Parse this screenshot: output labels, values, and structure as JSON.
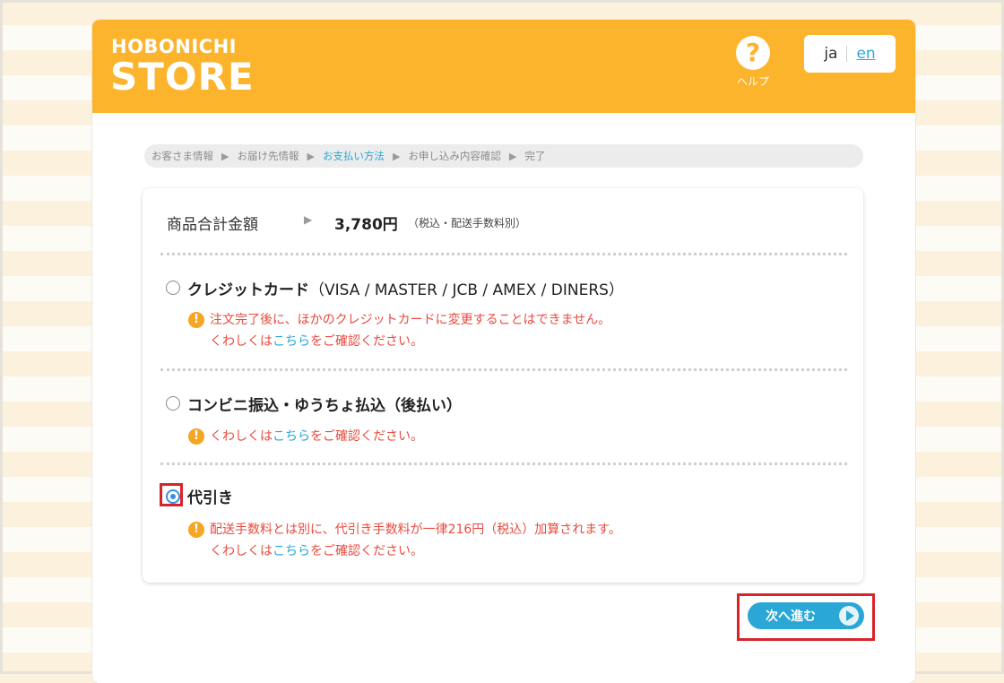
{
  "header": {
    "logo_top": "HOBONICHI",
    "logo_bottom": "STORE",
    "help_icon": "?",
    "help_label": "ヘルプ",
    "lang_ja": "ja",
    "lang_en": "en"
  },
  "steps": [
    {
      "label": "お客さま情報",
      "active": false
    },
    {
      "label": "お届け先情報",
      "active": false
    },
    {
      "label": "お支払い方法",
      "active": true
    },
    {
      "label": "お申し込み内容確認",
      "active": false
    },
    {
      "label": "完了",
      "active": false
    }
  ],
  "step_arrow": "▶",
  "total": {
    "label": "商品合計金額",
    "arrow": "▶",
    "amount": "3,780円",
    "note": "（税込・配送手数料別）"
  },
  "options": [
    {
      "label": "クレジットカード",
      "detail": "（VISA / MASTER / JCB / AMEX / DINERS）",
      "checked": false,
      "warning_line1": "注文完了後に、ほかのクレジットカードに変更することはできません。",
      "more_prefix": "くわしくは",
      "more_link": "こちら",
      "more_suffix": "をご確認ください。"
    },
    {
      "label": "コンビニ振込・ゆうちょ払込（後払い）",
      "detail": "",
      "checked": false,
      "warning_line1": "",
      "more_prefix": "くわしくは",
      "more_link": "こちら",
      "more_suffix": "をご確認ください。"
    },
    {
      "label": "代引き",
      "detail": "",
      "checked": true,
      "warning_line1": "配送手数料とは別に、代引き手数料が一律216円（税込）加算されます。",
      "more_prefix": "くわしくは",
      "more_link": "こちら",
      "more_suffix": "をご確認ください。"
    }
  ],
  "warning_icon": "!",
  "next_button": {
    "label": "次へ進む"
  },
  "colors": {
    "header": "#fbb42c",
    "accent": "#2aa7d6",
    "warning_text": "#e84a3e",
    "warning_icon": "#f5a623",
    "highlight": "#d8232a"
  }
}
